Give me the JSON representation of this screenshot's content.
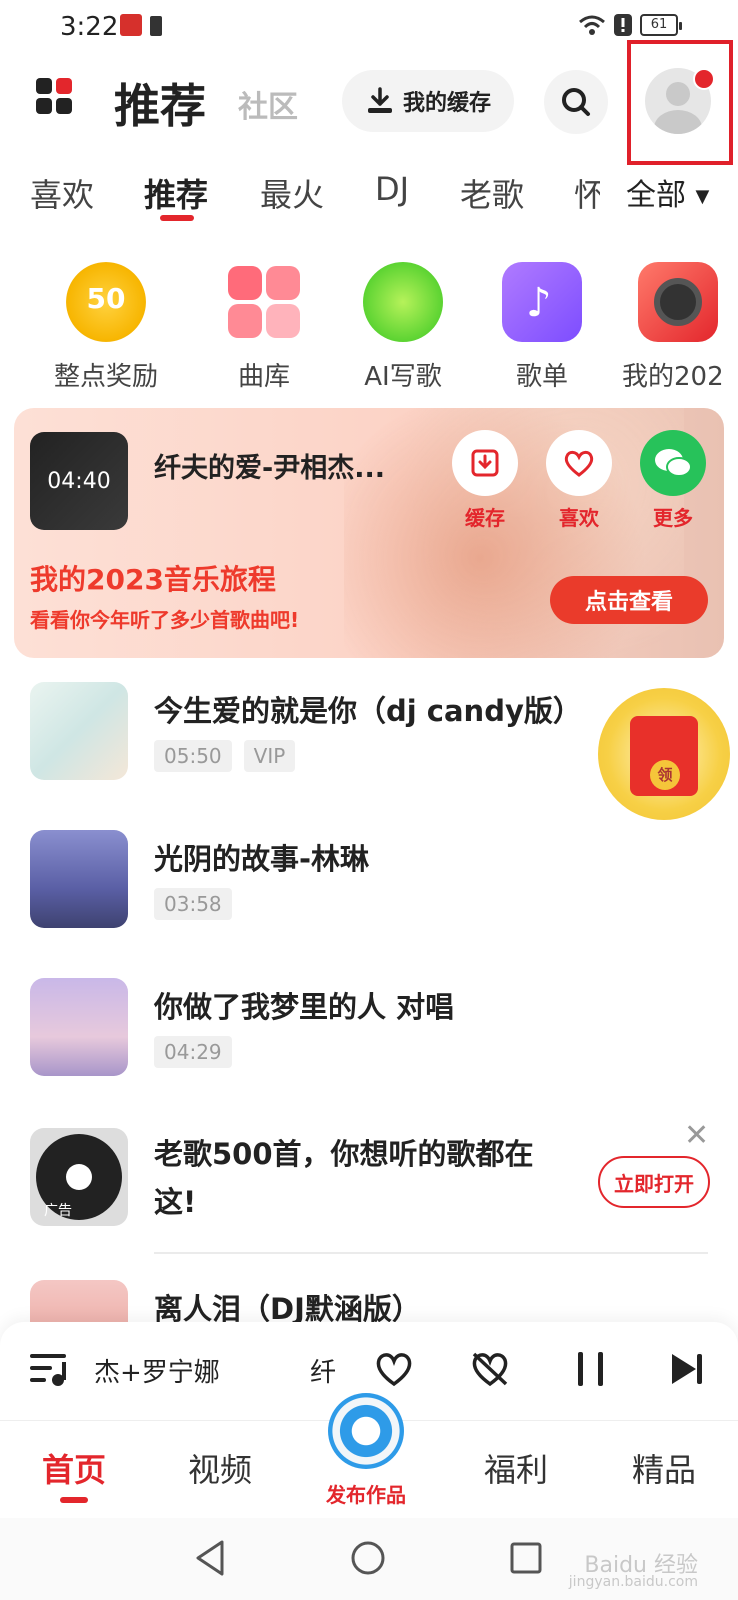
{
  "status_bar": {
    "time": "3:22",
    "battery": "61"
  },
  "header": {
    "title": "推荐",
    "subtitle": "社区",
    "cache_button": "我的缓存",
    "search_icon": "search-icon",
    "avatar_icon": "user-avatar-icon"
  },
  "category_tabs": {
    "items": [
      "喜欢",
      "推荐",
      "最火",
      "DJ",
      "老歌",
      "怀"
    ],
    "active": "推荐",
    "all_label": "全部"
  },
  "shortcuts": [
    {
      "label": "整点奖励",
      "badge": "50"
    },
    {
      "label": "曲库"
    },
    {
      "label": "AI写歌"
    },
    {
      "label": "歌单"
    },
    {
      "label": "我的202"
    }
  ],
  "banner": {
    "duration": "04:40",
    "song": "纤夫的爱-尹相杰...",
    "actions": [
      "缓存",
      "喜欢",
      "更多"
    ],
    "headline": "我的2023音乐旅程",
    "subline": "看看你今年听了多少首歌曲吧!",
    "cta": "点击查看"
  },
  "songs": [
    {
      "title": "今生爱的就是你（dj  candy版）",
      "duration": "05:50",
      "vip": "VIP"
    },
    {
      "title": "光阴的故事-林琳",
      "duration": "03:58"
    },
    {
      "title": "你做了我梦里的人 对唱",
      "duration": "04:29"
    }
  ],
  "redpacket": {
    "label": "领"
  },
  "ad": {
    "title": "老歌500首，你想听的歌都在这!",
    "badge": "广告",
    "button": "立即打开"
  },
  "next_song": {
    "title": "离人泪（DJ默涵版）"
  },
  "player": {
    "artist": "杰+罗宁娜",
    "title_fragment": "纤"
  },
  "bottom_nav": {
    "items": [
      "首页",
      "视频",
      "福利",
      "精品"
    ],
    "active": "首页",
    "publish": "发布作品"
  },
  "colors": {
    "accent": "#e3262c",
    "banner_bg": "#fcd3c6"
  },
  "watermark": {
    "line1": "Baidu 经验",
    "line2": "jingyan.baidu.com"
  }
}
